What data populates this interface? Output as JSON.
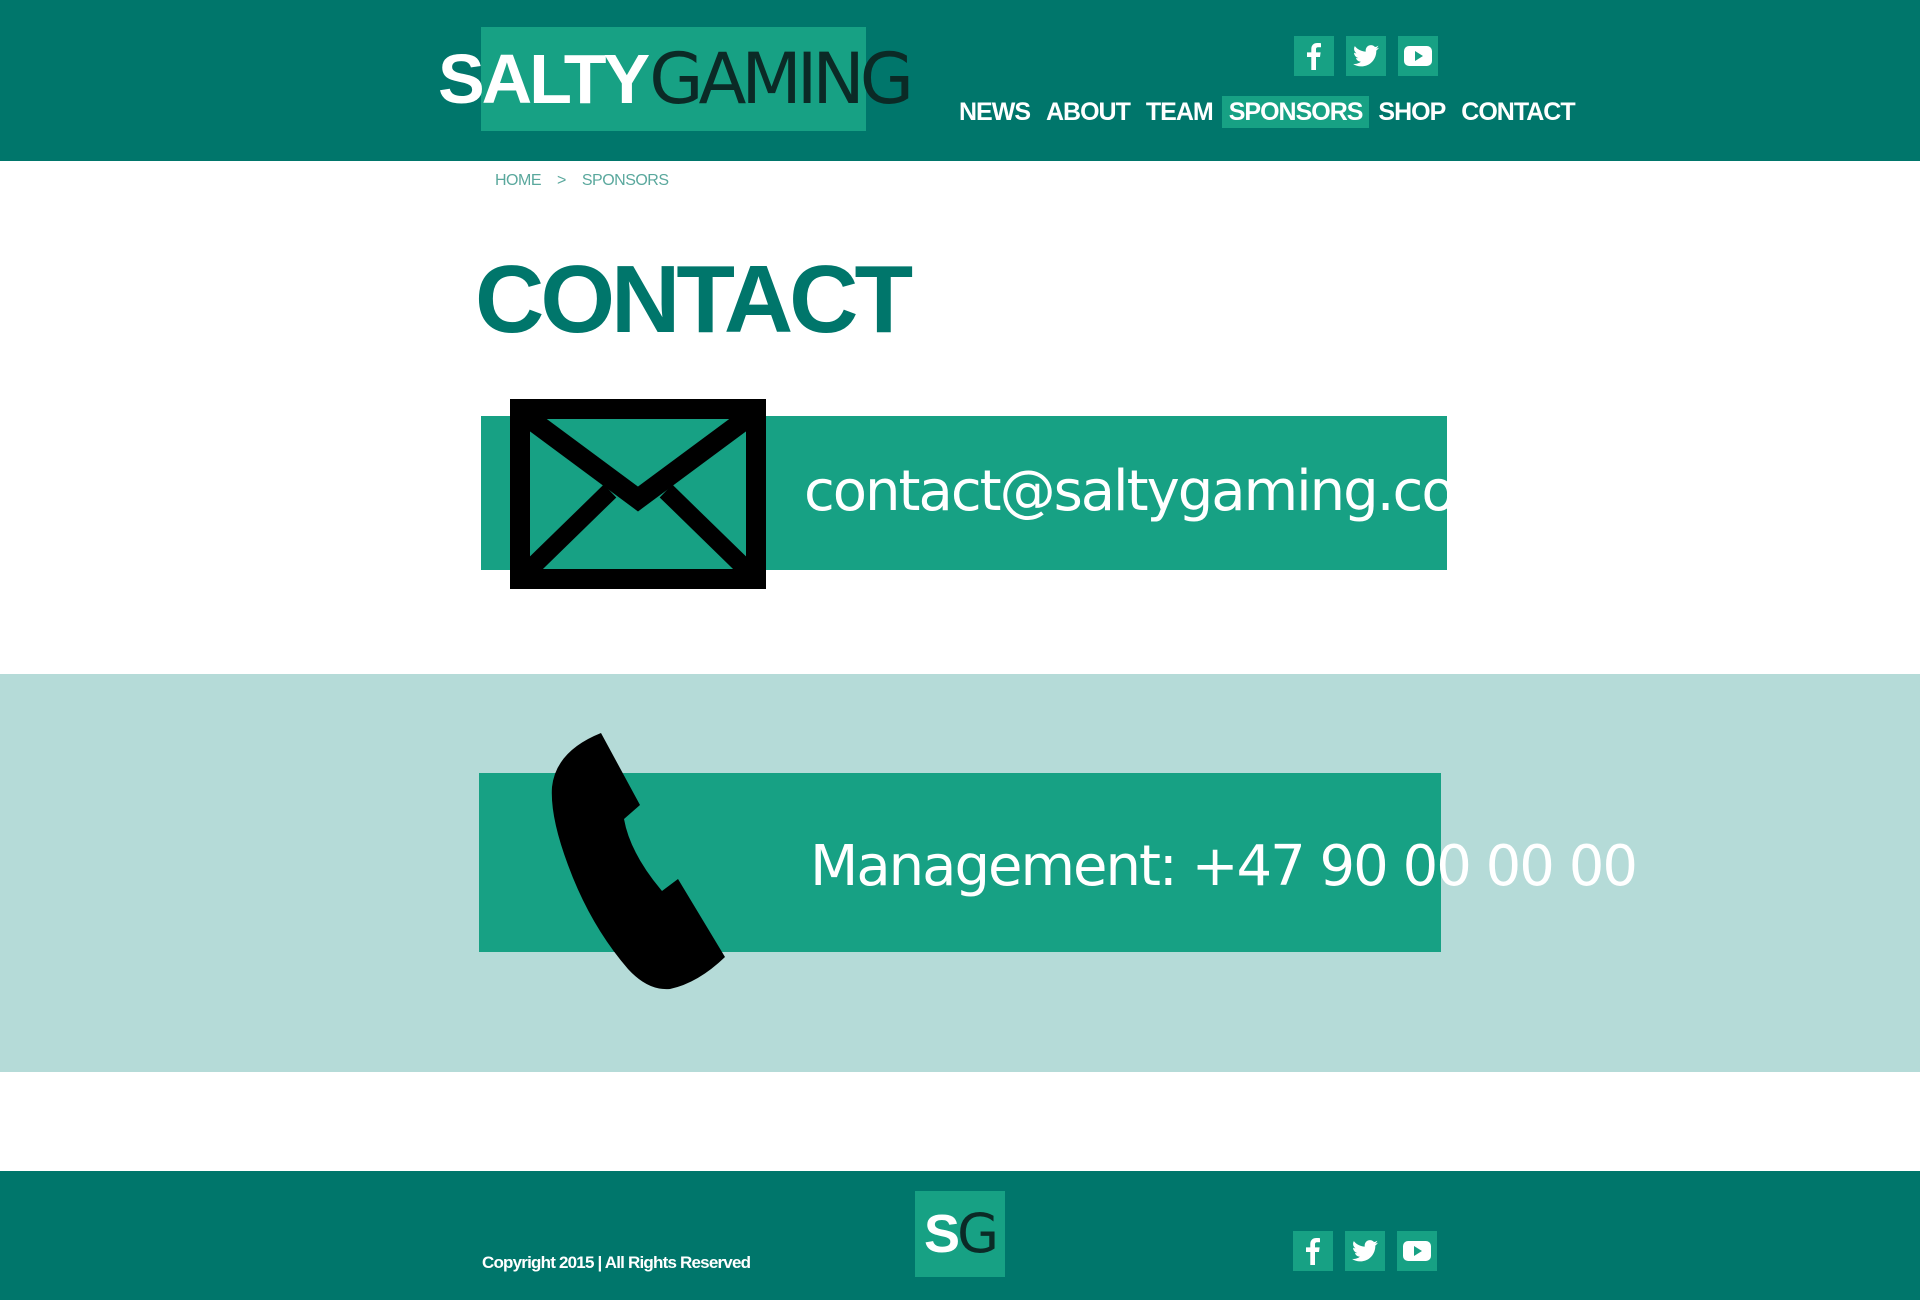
{
  "colors": {
    "primary_dark": "#00766b",
    "accent": "#17a184",
    "band_light": "#b5dbd8",
    "text_light": "#ffffff",
    "icon_black": "#000000"
  },
  "header": {
    "logo": {
      "strong": "SALTY",
      "light": "GAMING"
    },
    "social": [
      "facebook-icon",
      "twitter-icon",
      "youtube-icon"
    ],
    "nav": [
      {
        "label": "NEWS",
        "active": false
      },
      {
        "label": "ABOUT",
        "active": false
      },
      {
        "label": "TEAM",
        "active": false
      },
      {
        "label": "SPONSORS",
        "active": true
      },
      {
        "label": "SHOP",
        "active": false
      },
      {
        "label": "CONTACT",
        "active": false
      }
    ]
  },
  "breadcrumb": {
    "home": "HOME",
    "separator": ">",
    "current": "SPONSORS"
  },
  "page": {
    "title": "CONTACT"
  },
  "email": {
    "icon": "envelope-icon",
    "address": "contact@saltygaming.com"
  },
  "phone": {
    "icon": "phone-icon",
    "text": "Management: +47 90 00 00 00"
  },
  "footer": {
    "copyright": "Copyright 2015 | All Rights Reserved",
    "logo": {
      "s": "S",
      "g": "G"
    },
    "social": [
      "facebook-icon",
      "twitter-icon",
      "youtube-icon"
    ]
  }
}
